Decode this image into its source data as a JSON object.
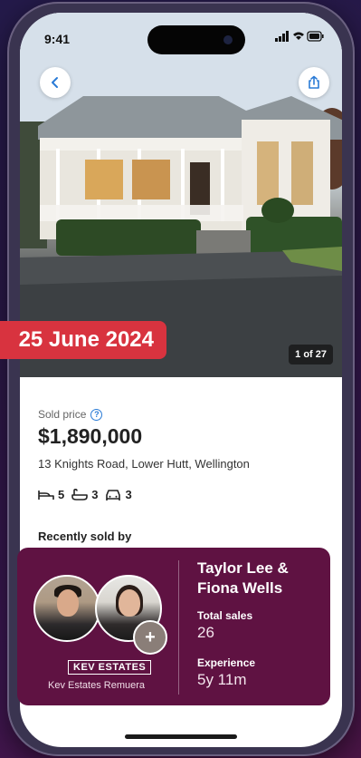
{
  "status_bar": {
    "time": "9:41",
    "icons": "▐▌ ◠ ▬"
  },
  "listing": {
    "photo_counter": "1 of 27",
    "sold_date": "25 June 2024",
    "sold_label": "Sold price",
    "sold_price": "$1,890,000",
    "address": "13 Knights Road, Lower Hutt, Wellington",
    "features": {
      "bedrooms": "5",
      "bathrooms": "3",
      "car_spaces": "3"
    },
    "recently_sold_heading": "Recently sold by"
  },
  "agent_card": {
    "names": [
      "Taylor Lee &",
      "Fiona Wells"
    ],
    "agency_logo": "KEV ESTATES",
    "agency_name": "Kev Estates Remuera",
    "add_badge": "+",
    "total_sales_label": "Total sales",
    "total_sales_value": "26",
    "experience_label": "Experience",
    "experience_value": "5y 11m"
  },
  "colors": {
    "banner": "#d8333f",
    "card": "#5f1242",
    "help": "#2a7bd6"
  }
}
